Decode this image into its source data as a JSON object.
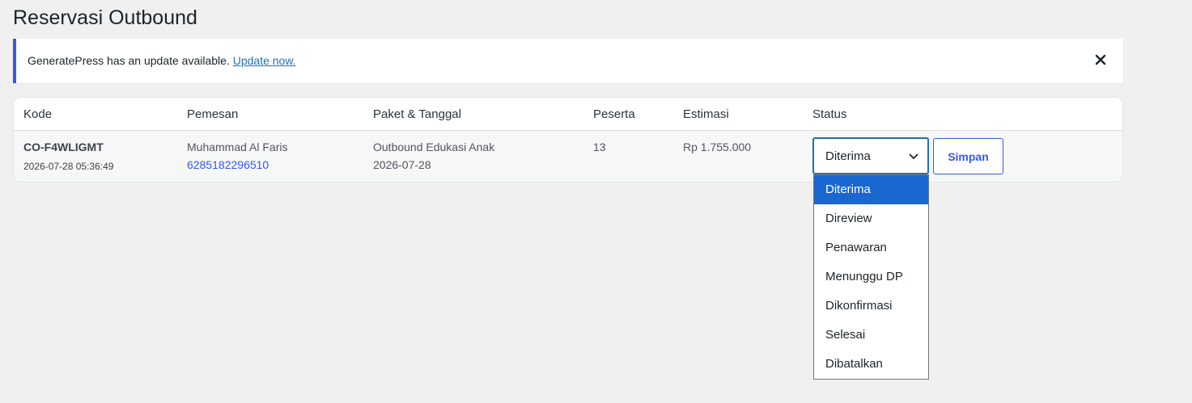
{
  "page": {
    "title": "Reservasi Outbound"
  },
  "notice": {
    "text": "GeneratePress has an update available. ",
    "link": "Update now.",
    "close_icon": "close-icon",
    "accent_color": "#3858e9"
  },
  "table": {
    "headers": [
      "Kode",
      "Pemesan",
      "Paket & Tanggal",
      "Peserta",
      "Estimasi",
      "Status"
    ],
    "rows": [
      {
        "code": "CO-F4WLIGMT",
        "datetime": "2026-07-28 05:36:49",
        "customer_name": "Muhammad Al Faris",
        "customer_phone": "6285182296510",
        "package": "Outbound Edukasi Anak",
        "date": "2026-07-28",
        "participants": "13",
        "estimate": "Rp 1.755.000",
        "status": "Diterima",
        "save_label": "Simpan"
      }
    ]
  },
  "status_dropdown": {
    "selected": "Diterima",
    "options": [
      "Diterima",
      "Direview",
      "Penawaran",
      "Menunggu DP",
      "Dikonfirmasi",
      "Selesai",
      "Dibatalkan"
    ],
    "selected_color": "#1a67d2"
  }
}
